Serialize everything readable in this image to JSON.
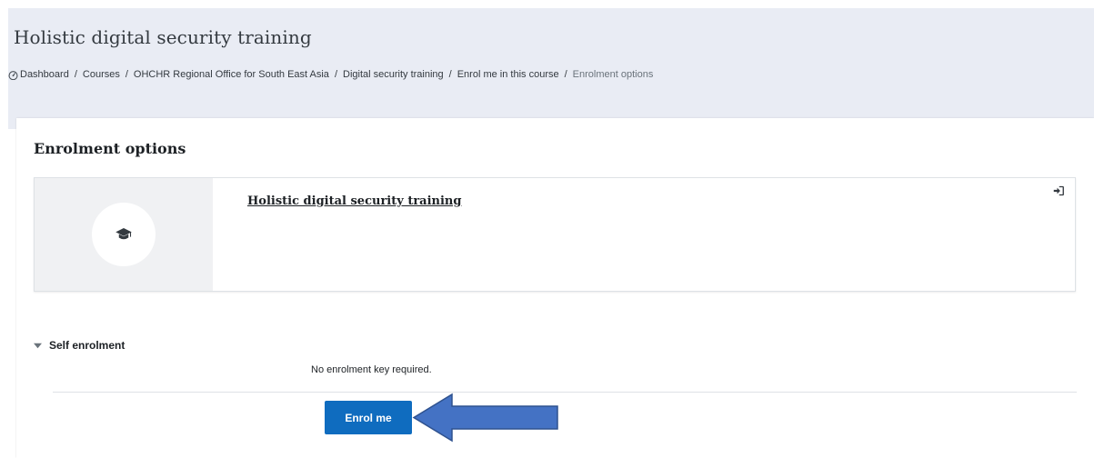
{
  "header": {
    "course_title": "Holistic digital security training",
    "breadcrumb": [
      "Dashboard",
      "Courses",
      "OHCHR Regional Office for South East Asia",
      "Digital security training",
      "Enrol me in this course",
      "Enrolment options"
    ],
    "breadcrumb_separator": "/"
  },
  "main": {
    "section_title": "Enrolment options",
    "course": {
      "name": "Holistic digital security training",
      "image_icon": "graduation-cap-icon",
      "enrol_indicator_icon": "sign-in-icon"
    },
    "self_enrolment": {
      "title": "Self enrolment",
      "note": "No enrolment key required.",
      "button_label": "Enrol me"
    }
  },
  "colors": {
    "header_bg": "#e9ecf4",
    "primary_button": "#0f6cbf",
    "annotation_arrow": "#4472c4",
    "annotation_arrow_border": "#2f528f"
  }
}
